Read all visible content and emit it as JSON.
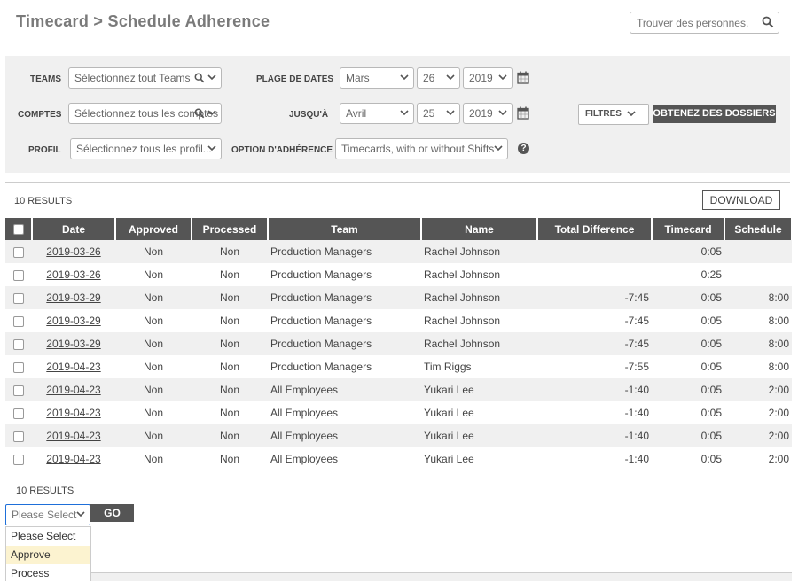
{
  "header": {
    "title": "Timecard > Schedule Adherence",
    "search_placeholder": "Trouver des personnes..",
    "search_icon": "search-icon"
  },
  "filters": {
    "teams_label": "TEAMS",
    "teams_placeholder": "Sélectionnez tout Teams",
    "accounts_label": "COMPTES",
    "accounts_placeholder": "Sélectionnez tous les comptes",
    "profile_label": "PROFIL",
    "profile_placeholder": "Sélectionnez tous les profil...",
    "date_range_label": "PLAGE DE DATES",
    "from_month": "Mars",
    "from_day": "26",
    "from_year": "2019",
    "until_label": "JUSQU'À",
    "to_month": "Avril",
    "to_day": "25",
    "to_year": "2019",
    "adherence_label": "OPTION D'ADHÉRENCE",
    "adherence_value": "Timecards, with or without Shifts",
    "filters_button": "FILTRES",
    "get_records_button": "OBTENEZ DES DOSSIERS",
    "help_glyph": "?"
  },
  "results": {
    "count_top": "10 RESULTS",
    "count_bottom": "10 RESULTS",
    "download_button": "DOWNLOAD"
  },
  "table": {
    "columns": [
      "Date",
      "Approved",
      "Processed",
      "Team",
      "Name",
      "Total Difference",
      "Timecard",
      "Schedule"
    ],
    "rows": [
      {
        "date": "2019-03-26",
        "approved": "Non",
        "processed": "Non",
        "team": "Production Managers",
        "name": "Rachel Johnson",
        "total_difference": "",
        "timecard": "0:05",
        "schedule": ""
      },
      {
        "date": "2019-03-26",
        "approved": "Non",
        "processed": "Non",
        "team": "Production Managers",
        "name": "Rachel Johnson",
        "total_difference": "",
        "timecard": "0:25",
        "schedule": ""
      },
      {
        "date": "2019-03-29",
        "approved": "Non",
        "processed": "Non",
        "team": "Production Managers",
        "name": "Rachel Johnson",
        "total_difference": "-7:45",
        "timecard": "0:05",
        "schedule": "8:00"
      },
      {
        "date": "2019-03-29",
        "approved": "Non",
        "processed": "Non",
        "team": "Production Managers",
        "name": "Rachel Johnson",
        "total_difference": "-7:45",
        "timecard": "0:05",
        "schedule": "8:00"
      },
      {
        "date": "2019-03-29",
        "approved": "Non",
        "processed": "Non",
        "team": "Production Managers",
        "name": "Rachel Johnson",
        "total_difference": "-7:45",
        "timecard": "0:05",
        "schedule": "8:00"
      },
      {
        "date": "2019-04-23",
        "approved": "Non",
        "processed": "Non",
        "team": "Production Managers",
        "name": "Tim Riggs",
        "total_difference": "-7:55",
        "timecard": "0:05",
        "schedule": "8:00"
      },
      {
        "date": "2019-04-23",
        "approved": "Non",
        "processed": "Non",
        "team": "All Employees",
        "name": "Yukari Lee",
        "total_difference": "-1:40",
        "timecard": "0:05",
        "schedule": "2:00"
      },
      {
        "date": "2019-04-23",
        "approved": "Non",
        "processed": "Non",
        "team": "All Employees",
        "name": "Yukari Lee",
        "total_difference": "-1:40",
        "timecard": "0:05",
        "schedule": "2:00"
      },
      {
        "date": "2019-04-23",
        "approved": "Non",
        "processed": "Non",
        "team": "All Employees",
        "name": "Yukari Lee",
        "total_difference": "-1:40",
        "timecard": "0:05",
        "schedule": "2:00"
      },
      {
        "date": "2019-04-23",
        "approved": "Non",
        "processed": "Non",
        "team": "All Employees",
        "name": "Yukari Lee",
        "total_difference": "-1:40",
        "timecard": "0:05",
        "schedule": "2:00"
      }
    ]
  },
  "actions": {
    "select_value": "Please Select",
    "go_button": "GO",
    "options": [
      "Please Select",
      "Approve",
      "Process"
    ],
    "highlighted_option": "Approve"
  },
  "colors": {
    "header_bg": "#555555",
    "panel_bg": "#f0f0f0",
    "highlight": "#fcf3d0",
    "focus_border": "#1e6fd9"
  }
}
